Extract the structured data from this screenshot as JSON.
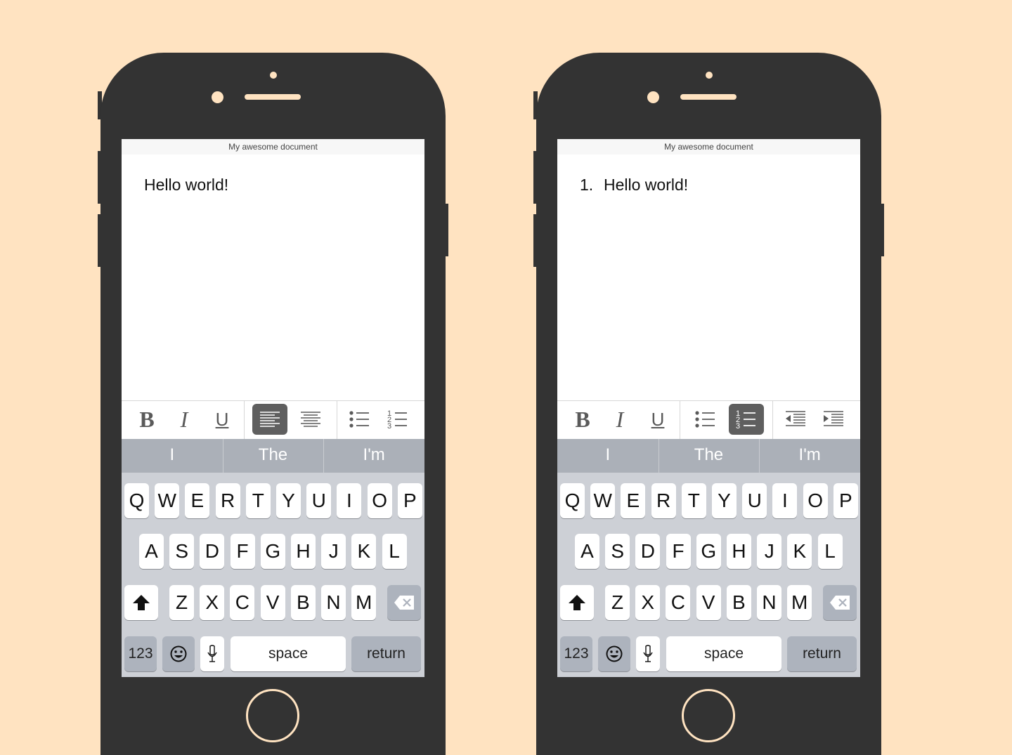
{
  "colors": {
    "background": "#FFE3C1",
    "phone_body": "#333333",
    "active_button": "#5F5F5F",
    "suggestion_bar": "#ABB0B8",
    "keyboard": "#CDD0D6"
  },
  "phones": [
    {
      "document_title": "My awesome document",
      "list_number": "",
      "document_text": "Hello world!",
      "toolbar_buttons": [
        {
          "icon": "bold-icon",
          "label": "B",
          "active": false
        },
        {
          "icon": "italic-icon",
          "label": "I",
          "active": false
        },
        {
          "icon": "underline-icon",
          "label": "U",
          "active": false
        },
        {
          "icon": "align-left-icon",
          "active": true
        },
        {
          "icon": "align-center-icon",
          "active": false
        },
        {
          "icon": "bulleted-list-icon",
          "active": false
        },
        {
          "icon": "numbered-list-icon",
          "active": false
        }
      ],
      "suggestions": [
        "I",
        "The",
        "I'm"
      ]
    },
    {
      "document_title": "My awesome document",
      "list_number": "1.",
      "document_text": "Hello world!",
      "toolbar_buttons": [
        {
          "icon": "bold-icon",
          "label": "B",
          "active": false
        },
        {
          "icon": "italic-icon",
          "label": "I",
          "active": false
        },
        {
          "icon": "underline-icon",
          "label": "U",
          "active": false
        },
        {
          "icon": "bulleted-list-icon",
          "active": false
        },
        {
          "icon": "numbered-list-icon",
          "active": true
        },
        {
          "icon": "outdent-icon",
          "active": false
        },
        {
          "icon": "indent-icon",
          "active": false
        }
      ],
      "suggestions": [
        "I",
        "The",
        "I'm"
      ]
    }
  ],
  "keyboard": {
    "row1": [
      "Q",
      "W",
      "E",
      "R",
      "T",
      "Y",
      "U",
      "I",
      "O",
      "P"
    ],
    "row2": [
      "A",
      "S",
      "D",
      "F",
      "G",
      "H",
      "J",
      "K",
      "L"
    ],
    "row3": [
      "Z",
      "X",
      "C",
      "V",
      "B",
      "N",
      "M"
    ],
    "numbers_key": "123",
    "space_key": "space",
    "return_key": "return"
  }
}
